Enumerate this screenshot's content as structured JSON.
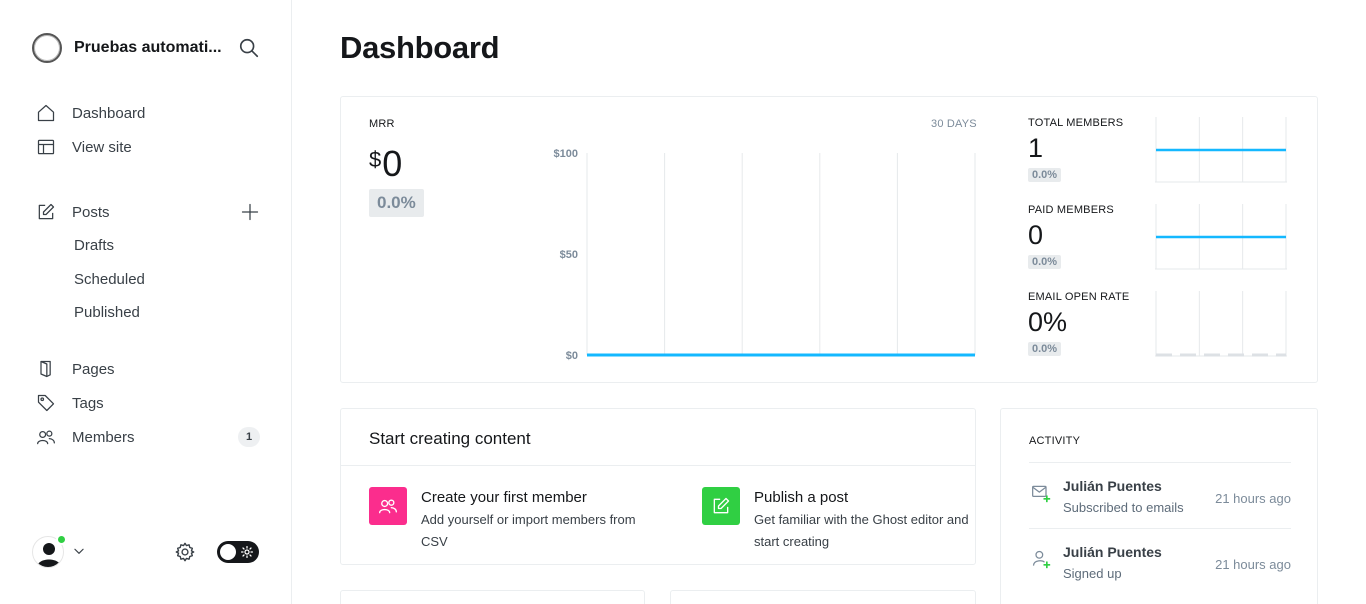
{
  "brand": {
    "name": "Pruebas automati..."
  },
  "nav": {
    "dashboard": "Dashboard",
    "view_site": "View site",
    "posts": "Posts",
    "drafts": "Drafts",
    "scheduled": "Scheduled",
    "published": "Published",
    "pages": "Pages",
    "tags": "Tags",
    "members": "Members",
    "members_count": "1"
  },
  "page": {
    "title": "Dashboard"
  },
  "mrr": {
    "label": "MRR",
    "currency": "$",
    "value": "0",
    "change": "0.0%",
    "period": "30 DAYS"
  },
  "metrics": {
    "total_members": {
      "label": "TOTAL MEMBERS",
      "value": "1",
      "change": "0.0%"
    },
    "paid_members": {
      "label": "PAID MEMBERS",
      "value": "0",
      "change": "0.0%"
    },
    "email_open_rate": {
      "label": "EMAIL OPEN RATE",
      "value": "0%",
      "change": "0.0%"
    }
  },
  "chart_data": [
    {
      "type": "line",
      "y_ticks": [
        "$100",
        "$50",
        "$0"
      ],
      "ylim": [
        0,
        100
      ],
      "series": [
        {
          "values": [
            0,
            0,
            0,
            0,
            0,
            0,
            0
          ]
        }
      ],
      "grid": true
    },
    {
      "type": "line",
      "ylim": [
        0,
        2
      ],
      "series": [
        {
          "values": [
            1,
            1,
            1,
            1
          ]
        }
      ]
    },
    {
      "type": "line",
      "ylim": [
        0,
        2
      ],
      "series": [
        {
          "values": [
            1,
            1,
            1,
            1
          ]
        }
      ]
    },
    {
      "type": "line",
      "ylim": [
        0,
        100
      ],
      "series": [
        {
          "values": [
            0,
            0,
            0,
            0,
            0,
            0
          ]
        }
      ]
    }
  ],
  "start": {
    "title": "Start creating content",
    "member": {
      "title": "Create your first member",
      "desc": "Add yourself or import members from CSV"
    },
    "post": {
      "title": "Publish a post",
      "desc": "Get familiar with the Ghost editor and start creating"
    }
  },
  "activity": {
    "label": "ACTIVITY",
    "items": [
      {
        "name": "Julián Puentes",
        "desc": "Subscribed to emails",
        "time": "21 hours ago"
      },
      {
        "name": "Julián Puentes",
        "desc": "Signed up",
        "time": "21 hours ago"
      }
    ]
  },
  "colors": {
    "accent_line": "#14b8ff",
    "pink": "#fb2d8d",
    "green": "#30cf43",
    "grid": "#e6e9eb"
  }
}
